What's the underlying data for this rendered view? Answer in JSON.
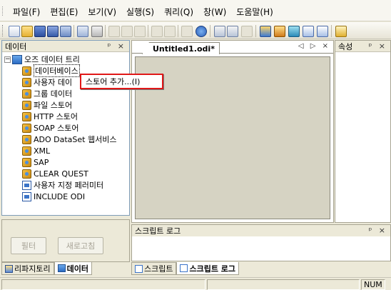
{
  "menu": {
    "items": [
      "파일(F)",
      "편집(E)",
      "보기(V)",
      "실행(S)",
      "쿼리(Q)",
      "창(W)",
      "도움말(H)"
    ]
  },
  "toolbar": {
    "icons": [
      "new-document-icon",
      "open-folder-icon",
      "save-icon",
      "save-all-icon",
      "edit-icon",
      "print-preview-icon",
      "print-icon",
      "cut-icon",
      "copy-icon",
      "paste-icon",
      "undo-icon",
      "redo-icon",
      "stop-icon",
      "help-icon",
      "report-icon",
      "report-view-icon",
      "pen-icon",
      "data-tree-icon",
      "database-icon",
      "form-icon",
      "window-icon",
      "panel-icon",
      "component-icon"
    ]
  },
  "left_panel": {
    "title": "데이터",
    "controls": "ᵖ ×",
    "tree": {
      "root": "오즈 데이터 트리",
      "items": [
        {
          "label": "데이터베이스",
          "icon": "database-store-icon"
        },
        {
          "label": "사용자 데이",
          "icon": "database-store-icon"
        },
        {
          "label": "그룹 데이터",
          "icon": "database-store-icon"
        },
        {
          "label": "파일 스토어",
          "icon": "database-store-icon"
        },
        {
          "label": "HTTP 스토어",
          "icon": "database-store-icon"
        },
        {
          "label": "SOAP 스토어",
          "icon": "database-store-icon"
        },
        {
          "label": "ADO DataSet 웹서비스",
          "icon": "database-store-icon"
        },
        {
          "label": "XML",
          "icon": "database-store-icon"
        },
        {
          "label": "SAP",
          "icon": "database-store-icon"
        },
        {
          "label": "CLEAR QUEST",
          "icon": "database-store-icon"
        },
        {
          "label": "사용자 지정 페러미터",
          "icon": "parameter-icon"
        },
        {
          "label": "INCLUDE ODI",
          "icon": "parameter-icon"
        }
      ]
    },
    "buttons": {
      "filter": "필터",
      "refresh": "새로고침"
    },
    "tabs": [
      "리파지토리",
      "데이터"
    ]
  },
  "context_menu": {
    "item": "스토어 추가...(I)"
  },
  "document": {
    "tab_title": "Untitled1.odi*",
    "controls": "◁ ▷ ×"
  },
  "property_panel": {
    "title": "속성",
    "controls": "ᵖ ×"
  },
  "script_panel": {
    "title": "스크립트 로그",
    "controls": "ᵖ ×"
  },
  "bottom_tabs": [
    "스크립트",
    "스크립트 로그"
  ],
  "status": {
    "num": "NUM"
  }
}
